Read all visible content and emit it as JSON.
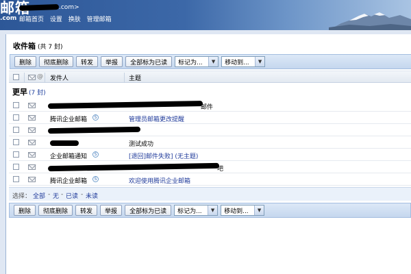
{
  "header": {
    "logo_text": "邮箱",
    "logo_suffix": ".com",
    "account_suffix": ".com>",
    "nav": [
      "邮箱首页",
      "设置",
      "换肤",
      "管理邮箱"
    ]
  },
  "folder": {
    "title": "收件箱",
    "count_text": "(共 7 封)"
  },
  "toolbar": {
    "buttons": [
      "删除",
      "彻底删除",
      "转发",
      "举报",
      "全部标为已读"
    ],
    "mark_select": "标记为...",
    "move_select": "移动到..."
  },
  "columns": {
    "sender": "发件人",
    "subject": "主题"
  },
  "group": {
    "title": "更早",
    "count_text": "(7 封)"
  },
  "messages": [
    {
      "sender": "",
      "subject": "邮件"
    },
    {
      "sender": "腾讯企业邮箱",
      "subject": "管理员邮箱更改提醒"
    },
    {
      "sender": "",
      "subject": ""
    },
    {
      "sender": "",
      "subject": "测试成功"
    },
    {
      "sender": "企业邮箱通知",
      "subject": "[退回]邮件失败] (无主题)"
    },
    {
      "sender": "",
      "subject": "吧"
    },
    {
      "sender": "腾讯企业邮箱",
      "subject": "欢迎使用腾讯企业邮箱"
    }
  ],
  "select_bar": {
    "label": "选择：",
    "options": [
      "全部",
      "无",
      "已读",
      "未读"
    ]
  },
  "colors": {
    "header_dark": "#2d5797",
    "link": "#1f3a9a",
    "toolbar_bg": "#c5d7ee"
  }
}
